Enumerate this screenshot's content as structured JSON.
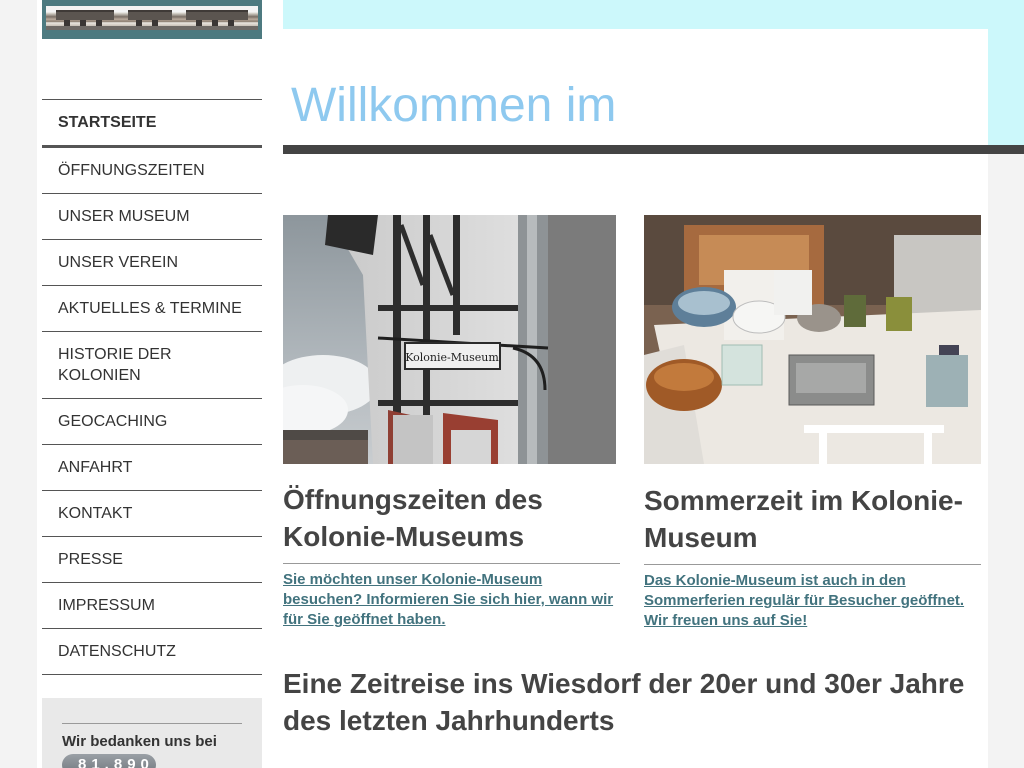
{
  "welcome": {
    "title": "Willkommen im"
  },
  "nav": {
    "items": [
      {
        "label": "STARTSEITE",
        "active": true
      },
      {
        "label": "ÖFFNUNGSZEITEN"
      },
      {
        "label": "UNSER MUSEUM"
      },
      {
        "label": "UNSER VEREIN"
      },
      {
        "label": "AKTUELLES & TERMINE"
      },
      {
        "label": "HISTORIE DER KOLONIEN"
      },
      {
        "label": "GEOCACHING"
      },
      {
        "label": "ANFAHRT"
      },
      {
        "label": "KONTAKT"
      },
      {
        "label": "PRESSE"
      },
      {
        "label": "IMPRESSUM"
      },
      {
        "label": "DATENSCHUTZ"
      }
    ]
  },
  "sidebar": {
    "thanks": "Wir bedanken uns bei",
    "counter": "81.890"
  },
  "cards": [
    {
      "photo_sign": "Kolonie-Museum",
      "title": "Öffnungszeiten des Kolonie-Museums",
      "teaser": "Sie möchten unser Kolonie-Museum besuchen? Informieren Sie sich hier, wann wir für Sie geöffnet haben."
    },
    {
      "title": "Sommerzeit im Kolonie-Museum",
      "teaser": "Das Kolonie-Museum ist auch in den Sommerferien regulär für Besucher geöffnet. Wir freuen uns auf Sie!"
    }
  ],
  "section": {
    "title": "Eine Zeitreise ins Wiesdorf der 20er und 30er Jahre des letzten Jahrhunderts"
  },
  "colors": {
    "accent": "#8ec9ef",
    "band": "#ccf8fb",
    "link": "#42737e",
    "dark": "#444444"
  }
}
